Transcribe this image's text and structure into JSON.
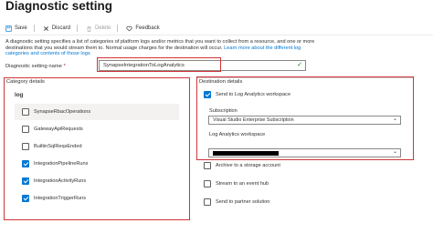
{
  "header": {
    "title": "Diagnostic setting"
  },
  "toolbar": {
    "save_label": "Save",
    "discard_label": "Discard",
    "delete_label": "Delete",
    "feedback_label": "Feedback"
  },
  "description": {
    "line1": "A diagnostic setting specifies a list of categories of platform logs and/or metrics that you want to collect from a resource, and one or more",
    "line2": "destinations that you would stream them to. Normal usage charges for the destination will occur.",
    "link1": "Learn more about the different log",
    "link2": "categories and contents of those logs"
  },
  "name_field": {
    "label": "Diagnostic setting name",
    "required_mark": "*",
    "value": "SynapseIntegrationToLogAnalytics"
  },
  "category_details": {
    "heading": "Category details",
    "log_heading": "log",
    "items": [
      {
        "label": "SynapseRbacOperations",
        "checked": false
      },
      {
        "label": "GatewayApiRequests",
        "checked": false
      },
      {
        "label": "BuiltinSqlReqsEnded",
        "checked": false
      },
      {
        "label": "IntegrationPipelineRuns",
        "checked": true
      },
      {
        "label": "IntegrationActivityRuns",
        "checked": true
      },
      {
        "label": "IntegrationTriggerRuns",
        "checked": true
      }
    ]
  },
  "destination_details": {
    "heading": "Destination details",
    "send_to_log_analytics": {
      "label": "Send to Log Analytics workspace",
      "checked": true
    },
    "subscription": {
      "label": "Subscription",
      "value": "Visual Studio Enterprise Subscription"
    },
    "workspace": {
      "label": "Log Analytics workspace",
      "value": ""
    },
    "other_options": [
      {
        "label": "Archive to a storage account",
        "checked": false
      },
      {
        "label": "Stream to an event hub",
        "checked": false
      },
      {
        "label": "Send to partner solution",
        "checked": false
      }
    ]
  },
  "colors": {
    "accent": "#0078d4",
    "highlight_border": "#d13438",
    "valid_check": "#107c10"
  }
}
